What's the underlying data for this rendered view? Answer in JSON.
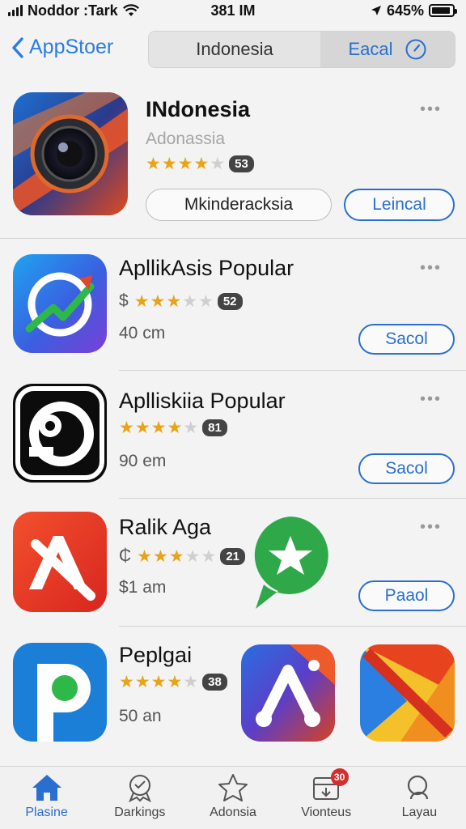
{
  "status_bar": {
    "carrier": "Noddor :Tark",
    "time": "381 IM",
    "battery_text": "645%",
    "battery_level": 0.9
  },
  "nav": {
    "back_label": "AppStoer",
    "segments": [
      "Indonesia",
      "Eacal"
    ]
  },
  "featured": {
    "title": "INdonesia",
    "subtitle": "Adonassia",
    "rating": 3.5,
    "rating_count": "53",
    "secondary_button": "Mkinderacksia",
    "action_button": "Leincal",
    "more": "•••"
  },
  "apps": [
    {
      "title": "ApllikAsis Popular",
      "price_symbol": "$",
      "rating": 3,
      "rating_count": "52",
      "meta": "40 cm",
      "action": "Sacol",
      "more": "•••"
    },
    {
      "title": "Aplliskiia Popular",
      "price_symbol": "",
      "rating": 4,
      "rating_count": "81",
      "meta": "90 em",
      "action": "Sacol",
      "more": "•••"
    },
    {
      "title": "Ralik Aga",
      "price_symbol": "₵",
      "rating": 3,
      "rating_count": "21",
      "meta": "$1 am",
      "action": "Paaol",
      "more": "•••"
    },
    {
      "title": "Peplgai",
      "price_symbol": "",
      "rating": 4,
      "rating_count": "38",
      "meta": "50 an",
      "action": "",
      "more": ""
    }
  ],
  "tabs": [
    {
      "label": "Plasine",
      "icon": "home-icon",
      "active": true
    },
    {
      "label": "Darkings",
      "icon": "badge-icon",
      "active": false
    },
    {
      "label": "Adonsia",
      "icon": "star-icon",
      "active": false
    },
    {
      "label": "Vionteus",
      "icon": "updates-icon",
      "active": false,
      "badge": "30"
    },
    {
      "label": "Layau",
      "icon": "search-icon",
      "active": false
    }
  ],
  "colors": {
    "accent": "#2a6fcf",
    "star": "#e8a317",
    "badge": "#d32f2f"
  }
}
